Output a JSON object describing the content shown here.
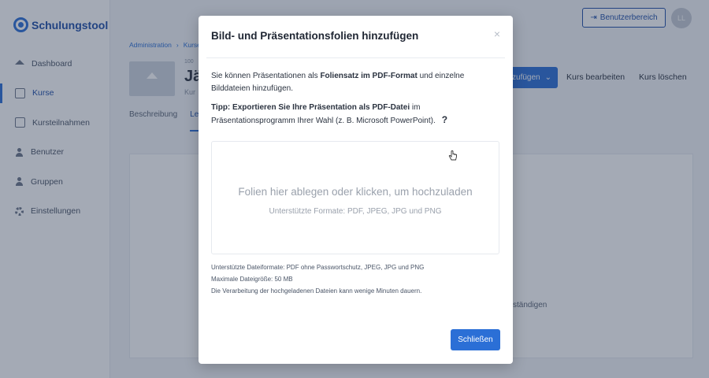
{
  "app": {
    "logo_text": "Schulungstool",
    "user_button": "Benutzerbereich",
    "avatar_initials": "LL"
  },
  "sidebar": {
    "items": [
      {
        "label": "Dashboard",
        "icon": "home-icon"
      },
      {
        "label": "Kurse",
        "icon": "course-icon",
        "active": true
      },
      {
        "label": "Kursteilnahmen",
        "icon": "enrollment-icon"
      },
      {
        "label": "Benutzer",
        "icon": "user-icon"
      },
      {
        "label": "Gruppen",
        "icon": "group-icon"
      },
      {
        "label": "Einstellungen",
        "icon": "gear-icon"
      }
    ]
  },
  "breadcrumb": [
    "Administration",
    "Kurse"
  ],
  "course": {
    "small_label": "100",
    "title": "Jä",
    "subtitle": "Kur"
  },
  "actions": {
    "add": "zufügen",
    "edit": "Kurs bearbeiten",
    "delete": "Kurs löschen"
  },
  "tabs": [
    "Beschreibung",
    "Le"
  ],
  "background_text": "ständigen",
  "modal": {
    "title": "Bild- und Präsentationsfolien hinzufügen",
    "close_symbol": "×",
    "intro_before": "Sie können Präsentationen als ",
    "intro_bold": "Foliensatz im PDF-Format",
    "intro_after": " und einzelne Bilddateien hinzufügen.",
    "tip_bold": "Tipp: Exportieren Sie Ihre Präsentation als PDF-Datei",
    "tip_after": " im Präsentationsprogramm Ihrer Wahl (z. B. Microsoft PowerPoint).",
    "tip_help": "?",
    "dropzone_main": "Folien hier ablegen oder klicken, um hochzuladen",
    "dropzone_sub": "Unterstützte Formate: PDF, JPEG, JPG und PNG",
    "notes": [
      "Unterstützte Dateiformate: PDF ohne Passwortschutz, JPEG, JPG und PNG",
      "Maximale Dateigröße: 50 MB",
      "Die Verarbeitung der hochgeladenen Dateien kann wenige Minuten dauern."
    ],
    "close_button": "Schließen"
  },
  "colors": {
    "primary": "#2b6fd6",
    "overlay": "#26344e"
  }
}
